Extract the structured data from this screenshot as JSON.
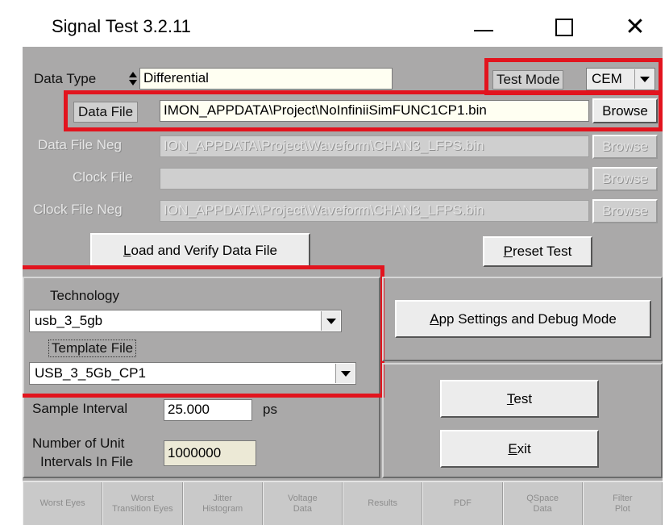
{
  "window": {
    "title": "Signal Test 3.2.11",
    "minimize_glyph": "—",
    "close_glyph": "✕"
  },
  "form": {
    "data_type_label": "Data Type",
    "data_type_value": "Differential",
    "test_mode_label": "Test Mode",
    "test_mode_value": "CEM",
    "data_file_label": "Data File",
    "data_file_value": "IMON_APPDATA\\Project\\NoInfiniiSimFUNC1CP1.bin",
    "data_file_neg_label": "Data File Neg",
    "data_file_neg_value": "ION_APPDATA\\Project\\Waveform\\CHAN3_LFPS.bin",
    "clock_file_label": "Clock File",
    "clock_file_value": "",
    "clock_file_neg_label": "Clock File Neg",
    "clock_file_neg_value": "ION_APPDATA\\Project\\Waveform\\CHAN3_LFPS.bin",
    "browse_label": "Browse"
  },
  "buttons": {
    "load_verify": "Load and Verify Data File",
    "preset_test": "Preset Test",
    "app_settings": "App Settings and Debug Mode",
    "test": "Test",
    "exit": "Exit"
  },
  "technology": {
    "label": "Technology",
    "value": "usb_3_5gb",
    "template_label": "Template File",
    "template_value": "USB_3_5Gb_CP1"
  },
  "sampling": {
    "sample_interval_label": "Sample Interval",
    "sample_interval_value": "25.000",
    "sample_interval_unit": "ps",
    "unit_intervals_label_1": "Number of Unit",
    "unit_intervals_label_2": "Intervals In File",
    "unit_intervals_value": "1000000"
  },
  "tabs": [
    {
      "line1": "Worst Eyes",
      "line2": ""
    },
    {
      "line1": "Worst",
      "line2": "Transition Eyes"
    },
    {
      "line1": "Jitter",
      "line2": "Histogram"
    },
    {
      "line1": "Voltage",
      "line2": "Data"
    },
    {
      "line1": "Results",
      "line2": ""
    },
    {
      "line1": "PDF",
      "line2": ""
    },
    {
      "line1": "QSpace",
      "line2": "Data"
    },
    {
      "line1": "Filter",
      "line2": "Plot"
    }
  ],
  "colors": {
    "highlight": "#e2141e",
    "background": "#aaa9a9"
  }
}
